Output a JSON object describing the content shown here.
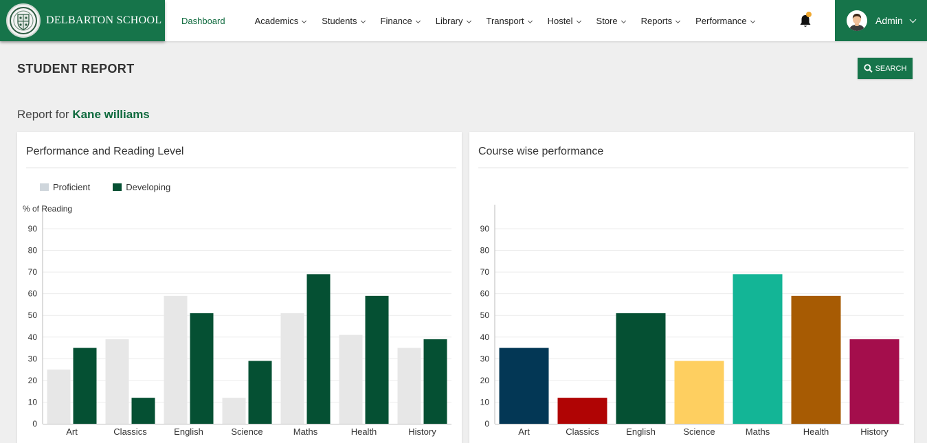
{
  "header": {
    "school_name": "DELBARTON SCHOOL",
    "nav": [
      {
        "label": "Dashboard",
        "active": true,
        "dropdown": false
      },
      {
        "label": "Academics",
        "dropdown": true
      },
      {
        "label": "Students",
        "dropdown": true
      },
      {
        "label": "Finance",
        "dropdown": true
      },
      {
        "label": "Library",
        "dropdown": true
      },
      {
        "label": "Transport",
        "dropdown": true
      },
      {
        "label": "Hostel",
        "dropdown": true
      },
      {
        "label": "Store",
        "dropdown": true
      },
      {
        "label": "Reports",
        "dropdown": true
      },
      {
        "label": "Performance",
        "dropdown": true
      }
    ],
    "notification_count": "0",
    "user_name": "Admin"
  },
  "page": {
    "title": "STUDENT REPORT",
    "search_label": "SEARCH",
    "report_for_label": "Report for",
    "student_name": "Kane williams"
  },
  "colors": {
    "brand": "#16744a",
    "proficient": "#e7e7e7",
    "developing": "#055033"
  },
  "chart_data": [
    {
      "type": "bar",
      "title": "Performance and Reading Level",
      "ylabel": "% of Reading",
      "xlabel": "",
      "categories": [
        "Art",
        "Classics",
        "English",
        "Science",
        "Maths",
        "Health",
        "History"
      ],
      "series": [
        {
          "name": "Proficient",
          "color": "#e7e7e7",
          "legend_color": "#cfd6dc",
          "values": [
            25,
            39,
            59,
            12,
            51,
            41,
            35
          ]
        },
        {
          "name": "Developing",
          "color": "#055033",
          "legend_color": "#055033",
          "values": [
            35,
            12,
            51,
            29,
            69,
            59,
            39
          ]
        }
      ],
      "yticks": [
        0,
        10,
        20,
        30,
        40,
        50,
        60,
        70,
        80,
        90
      ],
      "ylim": [
        0,
        90
      ],
      "grid": true,
      "legend": "top-left"
    },
    {
      "type": "bar",
      "title": "Course wise performance",
      "ylabel": "",
      "xlabel": "",
      "categories": [
        "Art",
        "Classics",
        "English",
        "Science",
        "Maths",
        "Health",
        "History"
      ],
      "values": [
        35,
        12,
        51,
        29,
        69,
        59,
        39
      ],
      "colors": [
        "#033755",
        "#b00404",
        "#055033",
        "#fecf60",
        "#13b596",
        "#a75b03",
        "#a40e4c"
      ],
      "yticks": [
        0,
        10,
        20,
        30,
        40,
        50,
        60,
        70,
        80,
        90
      ],
      "ylim": [
        0,
        90
      ],
      "grid": true,
      "legend": "none"
    }
  ]
}
